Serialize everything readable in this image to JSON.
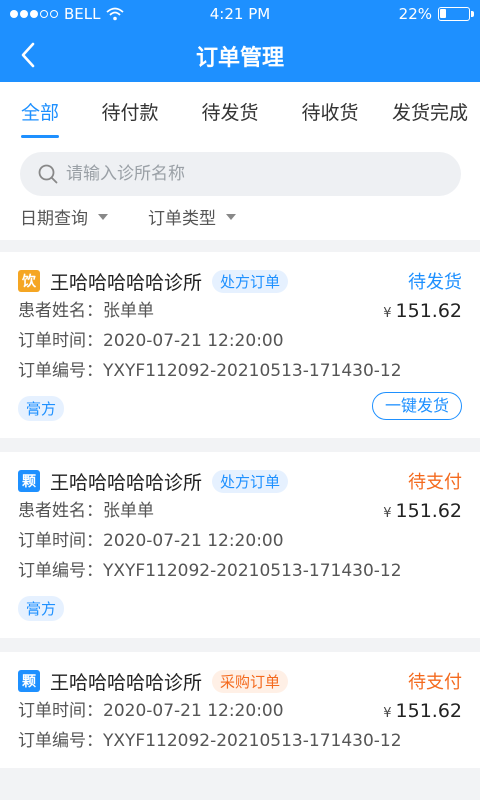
{
  "status_bar": {
    "carrier": "BELL",
    "time": "4:21 PM",
    "battery": "22%",
    "battery_level": 0.22
  },
  "header": {
    "title": "订单管理"
  },
  "tabs": [
    {
      "label": "全部",
      "active": true
    },
    {
      "label": "待付款",
      "active": false
    },
    {
      "label": "待发货",
      "active": false
    },
    {
      "label": "待收货",
      "active": false
    },
    {
      "label": "发货完成",
      "active": false
    }
  ],
  "search": {
    "placeholder": "请输入诊所名称"
  },
  "filters": {
    "date": "日期查询",
    "type": "订单类型"
  },
  "orders": [
    {
      "icon_char": "饮",
      "icon_color": "#f5a623",
      "clinic": "王哈哈哈哈哈诊所",
      "type": "处方订单",
      "status": "待发货",
      "patient_label": "患者姓名：",
      "patient": "张单单",
      "yen": "¥",
      "price": "151.62",
      "time_label": "订单时间：",
      "time": "2020-07-21 12:20:00",
      "no_label": "订单编号：",
      "no": "YXYF112092-20210513-171430-12",
      "tag": "膏方",
      "action": "一键发货"
    },
    {
      "icon_char": "颗",
      "icon_color": "#1e90ff",
      "clinic": "王哈哈哈哈哈诊所",
      "type": "处方订单",
      "status": "待支付",
      "patient_label": "患者姓名：",
      "patient": "张单单",
      "yen": "¥",
      "price": "151.62",
      "time_label": "订单时间：",
      "time": "2020-07-21 12:20:00",
      "no_label": "订单编号：",
      "no": "YXYF112092-20210513-171430-12",
      "tag": "膏方"
    },
    {
      "icon_char": "颗",
      "icon_color": "#1e90ff",
      "clinic": "王哈哈哈哈哈诊所",
      "type": "采购订单",
      "status": "待支付",
      "yen": "¥",
      "price": "151.62",
      "time_label": "订单时间：",
      "time": "2020-07-21 12:20:00",
      "no_label": "订单编号：",
      "no": "YXYF112092-20210513-171430-12"
    }
  ]
}
